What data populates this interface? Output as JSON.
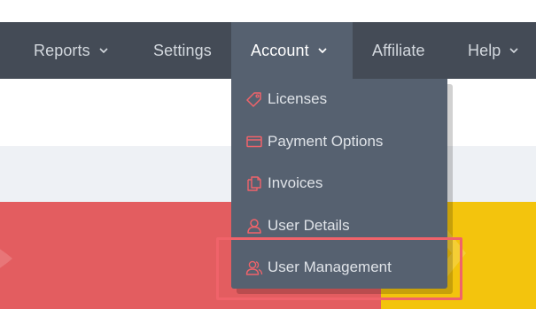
{
  "nav": {
    "items": [
      {
        "label": "Reports",
        "has_chevron": true
      },
      {
        "label": "Settings",
        "has_chevron": false
      },
      {
        "label": "Account",
        "has_chevron": true,
        "active": true
      },
      {
        "label": "Affiliate",
        "has_chevron": false
      },
      {
        "label": "Help",
        "has_chevron": true
      }
    ]
  },
  "account_menu": {
    "items": [
      {
        "label": "Licenses",
        "icon": "tag-icon"
      },
      {
        "label": "Payment Options",
        "icon": "credit-card-icon"
      },
      {
        "label": "Invoices",
        "icon": "documents-icon"
      },
      {
        "label": "User Details",
        "icon": "user-icon"
      },
      {
        "label": "User Management",
        "icon": "users-icon",
        "highlighted": true
      }
    ]
  },
  "colors": {
    "nav_bg": "#444b56",
    "nav_active_bg": "#566170",
    "dropdown_bg": "#566170",
    "icon_accent": "#f0636a",
    "highlight_border": "#f0636a",
    "red_band": "#e35d60",
    "yellow_band": "#f3c40d",
    "light_band": "#eef1f5"
  }
}
